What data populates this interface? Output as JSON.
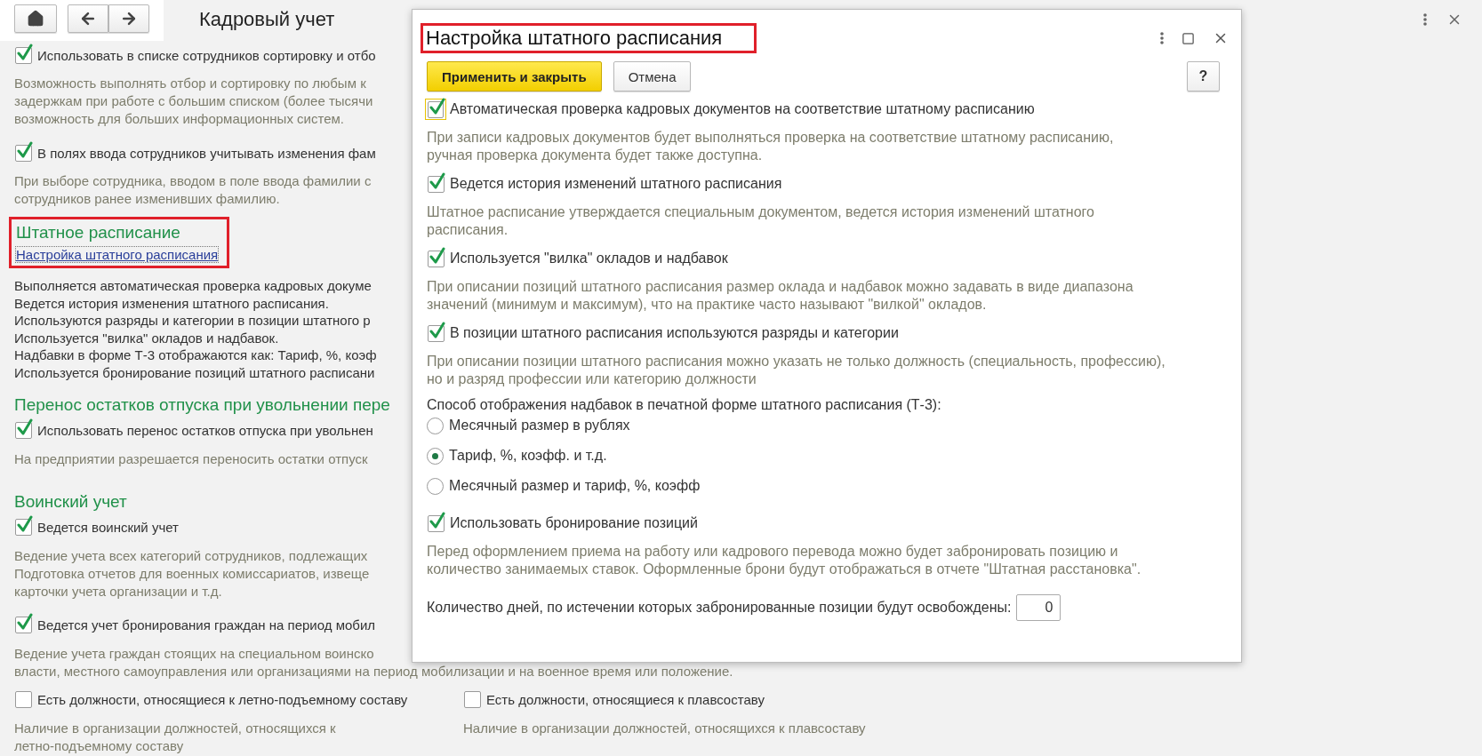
{
  "toolbar": {
    "title": "Кадровый учет"
  },
  "page": {
    "items": [
      {
        "kind": "checkbox",
        "label": "Использовать в списке сотрудников сортировку и отбо",
        "checked": true
      },
      {
        "kind": "note",
        "text": "Возможность выполнять отбор и сортировку по любым к\nзадержкам при работе с большим списком (более тысячи\nвозможность для больших информационных систем."
      },
      {
        "kind": "checkbox",
        "label": "В полях ввода сотрудников учитывать изменения фам",
        "checked": true
      },
      {
        "kind": "note",
        "text": "При выборе сотрудника, вводом в поле ввода фамилии с\nсотрудников ранее изменивших фамилию."
      },
      {
        "kind": "section",
        "title": "Штатное расписание",
        "link": "Настройка штатного расписания",
        "highlighted": true
      },
      {
        "kind": "summary",
        "lines": [
          "Выполняется автоматическая проверка кадровых докуме",
          "Ведется история изменения штатного расписания.",
          "Используются разряды и категории в позиции штатного р",
          "Используется \"вилка\" окладов и надбавок.",
          "Надбавки в форме Т-3 отображаются как: Тариф, %, коэф",
          "Используется бронирование позиций штатного расписани"
        ]
      },
      {
        "kind": "heading",
        "title": "Перенос остатков отпуска при увольнении пере"
      },
      {
        "kind": "checkbox",
        "label": "Использовать перенос остатков отпуска при увольнен",
        "checked": true
      },
      {
        "kind": "note",
        "text": "На предприятии разрешается переносить остатки отпуск"
      },
      {
        "kind": "heading",
        "title": "Воинский учет"
      },
      {
        "kind": "checkbox",
        "label": "Ведется воинский учет",
        "checked": true
      },
      {
        "kind": "note",
        "text": "Ведение учета всех категорий сотрудников, подлежащих\nПодготовка отчетов для военных комиссариатов, извеще\nкарточки учета организации и т.д."
      },
      {
        "kind": "checkbox",
        "label": "Ведется учет бронирования граждан на период мобил",
        "checked": true
      },
      {
        "kind": "note",
        "text": "Ведение учета граждан стоящих на специальном воинско\nвласти, местного самоуправления или организациями на период мобилизации и на военное время или положение."
      },
      {
        "kind": "pair",
        "columns": [
          {
            "label": "Есть должности, относящиеся к летно-подъемному составу",
            "checked": false,
            "note": "Наличие в организации должностей, относящихся к\nлетно-подъемному составу"
          },
          {
            "label": "Есть должности, относящиеся к плавсоставу",
            "checked": false,
            "note": "Наличие в организации должностей, относящихся к плавсоставу"
          }
        ]
      }
    ]
  },
  "dialog": {
    "title": "Настройка штатного расписания",
    "highlighted": true,
    "buttons": [
      {
        "label": "Применить и закрыть",
        "primary": true
      },
      {
        "label": "Отмена",
        "primary": false
      }
    ],
    "help": "?",
    "options": [
      {
        "kind": "checkbox",
        "label": "Автоматическая проверка кадровых документов на соответствие штатному расписанию",
        "checked": true,
        "focused": true,
        "note": "При записи кадровых документов будет выполняться проверка на соответствие штатному расписанию,\nручная проверка документа будет также доступна."
      },
      {
        "kind": "checkbox",
        "label": "Ведется история изменений штатного расписания",
        "checked": true,
        "focused": false,
        "note": "Штатное расписание утверждается специальным документом, ведется история изменений штатного\nрасписания."
      },
      {
        "kind": "checkbox",
        "label": "Используется \"вилка\" окладов и надбавок",
        "checked": true,
        "focused": false,
        "note": "При описании позиций штатного расписания размер оклада и надбавок можно задавать в виде диапазона\nзначений (минимум и максимум), что на практике часто называют \"вилкой\" окладов."
      },
      {
        "kind": "checkbox",
        "label": "В позиции штатного расписания используются разряды и категории",
        "checked": true,
        "focused": false,
        "note": "При описании позиции штатного расписания можно указать не только должность (специальность, профессию),\nно и разряд профессии или категорию должности"
      },
      {
        "kind": "caption",
        "text": "Способ отображения надбавок в печатной форме штатного расписания (Т-3):"
      },
      {
        "kind": "radio",
        "label": "Месячный размер в рублях",
        "selected": false
      },
      {
        "kind": "radio",
        "label": "Тариф, %, коэфф. и т.д.",
        "selected": true
      },
      {
        "kind": "radio",
        "label": "Месячный размер и тариф, %, коэфф",
        "selected": false
      },
      {
        "kind": "checkbox",
        "label": "Использовать бронирование позиций",
        "checked": true,
        "focused": false,
        "note": "Перед оформлением приема на работу или кадрового перевода можно будет забронировать позицию и\nколичество занимаемых ставок. Оформленные брони будут отображаться в отчете \"Штатная расстановка\"."
      },
      {
        "kind": "number",
        "label": "Количество дней, по истечении которых забронированные позиции будут освобождены:",
        "value": "0"
      }
    ]
  }
}
